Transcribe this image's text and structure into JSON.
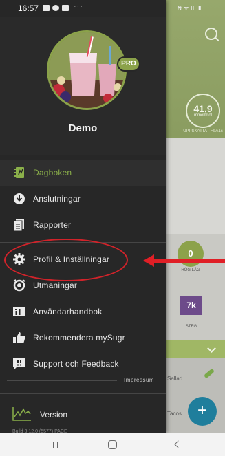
{
  "status_bar": {
    "time": "16:57",
    "dots": "···",
    "right_icons": "₦ ᯤ ǀǀǀ ▮"
  },
  "background_app": {
    "hba1c_value": "41,9",
    "hba1c_unit": "mmol/mol",
    "hba1c_label": "UPPSKATTAT HbA1c",
    "fav_value": "0",
    "fav_label": "HÖG LÅG",
    "steps_value": "7k",
    "steps_label": "STEG",
    "list_item_1": "Sallad",
    "list_item_2": "Tacos",
    "fab_label": "+"
  },
  "drawer": {
    "badge": "PRO",
    "username": "Demo",
    "nav": [
      {
        "label": "Dagboken",
        "icon": "diary-icon",
        "active": true
      },
      {
        "label": "Anslutningar",
        "icon": "connections-icon"
      },
      {
        "label": "Rapporter",
        "icon": "reports-icon"
      },
      {
        "label": "Profil & Inställningar",
        "icon": "gear-icon"
      },
      {
        "label": "Utmaningar",
        "icon": "challenges-icon"
      },
      {
        "label": "Användarhandbok",
        "icon": "manual-icon"
      },
      {
        "label": "Rekommendera mySugr",
        "icon": "thumbs-up-icon"
      },
      {
        "label": "Support och Feedback",
        "icon": "feedback-icon"
      }
    ],
    "impressum": "Impressum",
    "version_label": "Version",
    "version_sub": "Build 3.12.0 (5577) PACE"
  },
  "colors": {
    "accent": "#8bb04a",
    "drawer_bg": "#272727",
    "annotation": "#e01f26"
  }
}
